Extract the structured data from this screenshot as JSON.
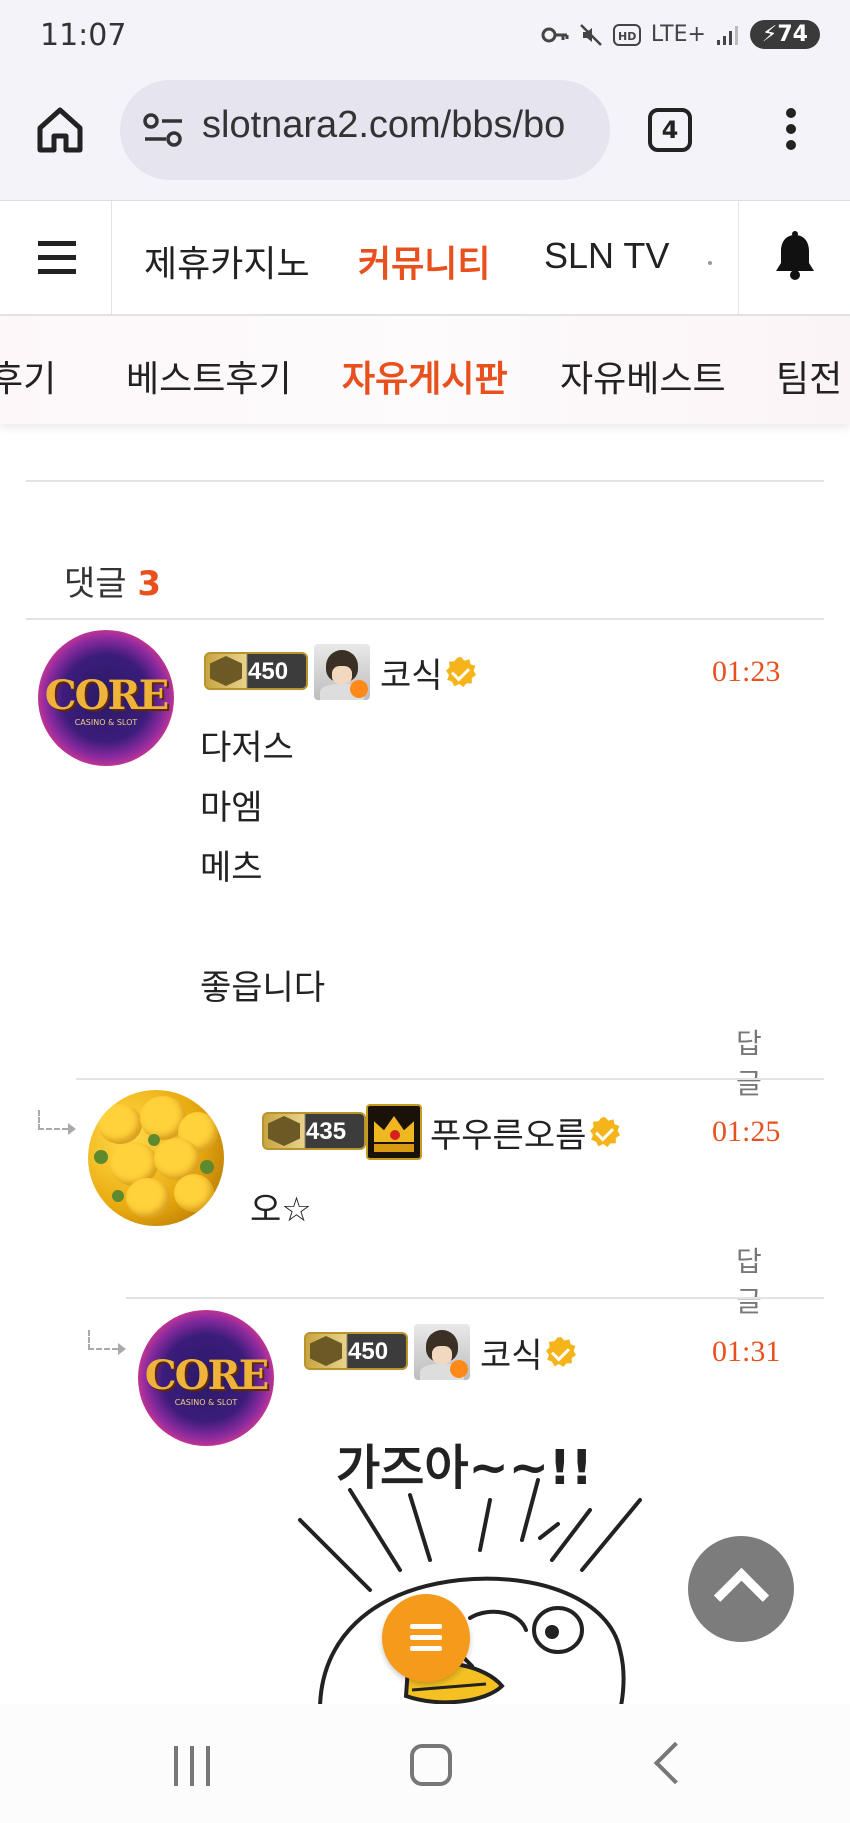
{
  "status_bar": {
    "time": "11:07",
    "network": "LTE+",
    "battery": "74"
  },
  "browser": {
    "url": "slotnara2.com/bbs/bo",
    "tab_count": "4"
  },
  "site_nav": {
    "items": [
      {
        "label": "제휴카지노",
        "active": false
      },
      {
        "label": "커뮤니티",
        "active": true
      },
      {
        "label": "SLN TV",
        "active": false
      }
    ]
  },
  "sub_nav": {
    "items": [
      {
        "label": "후기",
        "active": false
      },
      {
        "label": "베스트후기",
        "active": false
      },
      {
        "label": "자유게시판",
        "active": true
      },
      {
        "label": "자유베스트",
        "active": false
      },
      {
        "label": "팀전",
        "active": false
      }
    ]
  },
  "comments_header": {
    "label": "댓글",
    "count": "3"
  },
  "comments": [
    {
      "level": "450",
      "nickname": "코식",
      "time": "01:23",
      "text": "다저스\n마엠\n메츠\n\n좋읍니다",
      "reply_label": "답글"
    },
    {
      "level": "435",
      "nickname": "푸우른오름",
      "time": "01:25",
      "text": "오☆",
      "reply_label": "답글"
    },
    {
      "level": "450",
      "nickname": "코식",
      "time": "01:31",
      "sticker_text": "가즈아~~!!"
    }
  ],
  "avatars": {
    "core_logo": "CORE",
    "core_sub": "CASINO & SLOT"
  },
  "colors": {
    "accent": "#e8501e",
    "fab_menu": "#f59a1a",
    "fab_up": "#7c7c7c",
    "verified": "#f5b41a"
  },
  "icons": [
    "home-icon",
    "tune-icon",
    "more-vert-icon",
    "menu-icon",
    "bell-icon",
    "verified-icon",
    "reply-arrow-icon",
    "chevron-up-icon"
  ]
}
